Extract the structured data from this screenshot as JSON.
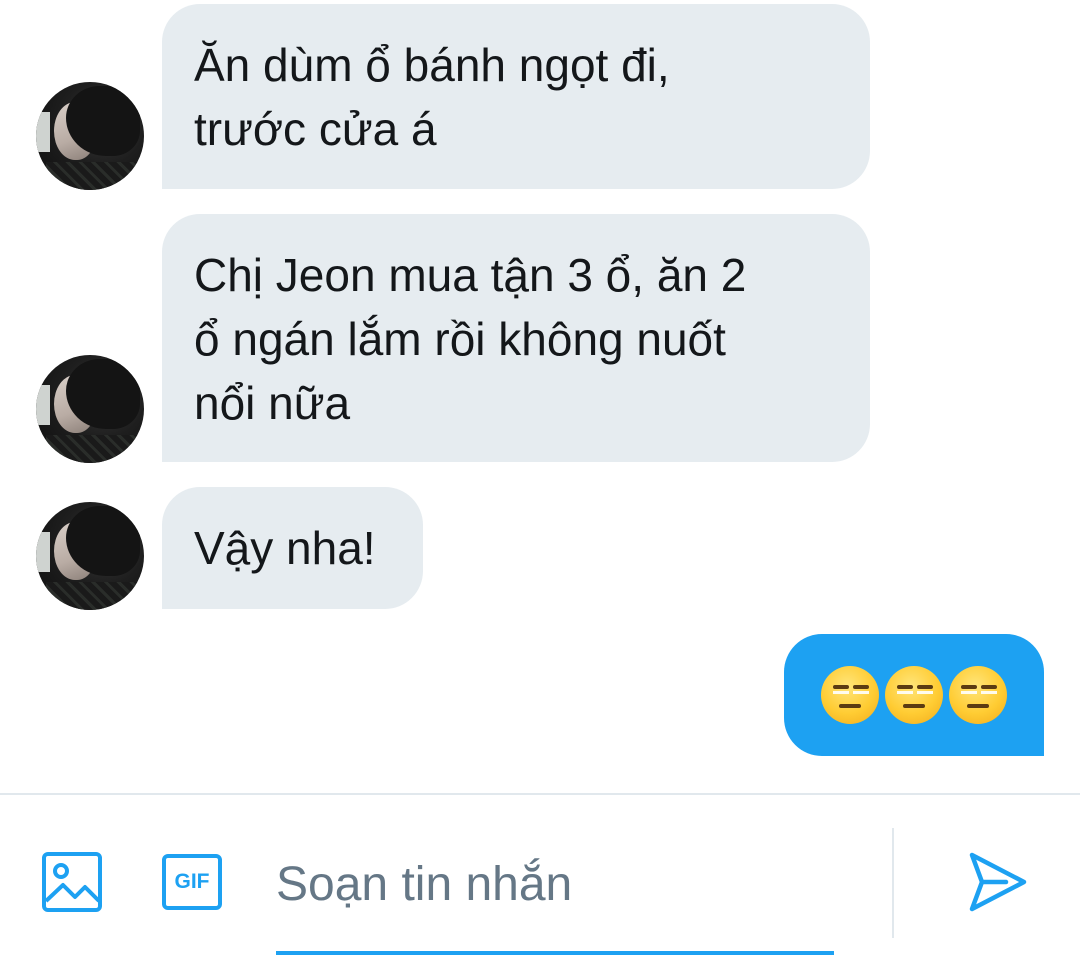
{
  "conversation": {
    "incoming": [
      {
        "lines": [
          "Ăn dùm ổ bánh ngọt đi,",
          "trước cửa á"
        ]
      },
      {
        "lines": [
          "Chị Jeon mua tận 3 ổ, ăn 2",
          "ổ ngán lắm rồi không nuốt",
          "nổi nữa"
        ]
      },
      {
        "lines": [
          "Vậy nha!"
        ]
      }
    ],
    "outgoing": [
      {
        "emoji": [
          "expressionless-face-emoji",
          "expressionless-face-emoji",
          "expressionless-face-emoji"
        ]
      }
    ]
  },
  "composer": {
    "placeholder": "Soạn tin nhắn",
    "value": "",
    "media_icon": "image-icon",
    "gif_label": "GIF",
    "send_icon": "send-icon"
  },
  "colors": {
    "accent": "#1da1f2",
    "incoming_bubble": "#e6ecf0",
    "text": "#14171a",
    "placeholder": "#657786",
    "divider": "#e1e8ed"
  }
}
